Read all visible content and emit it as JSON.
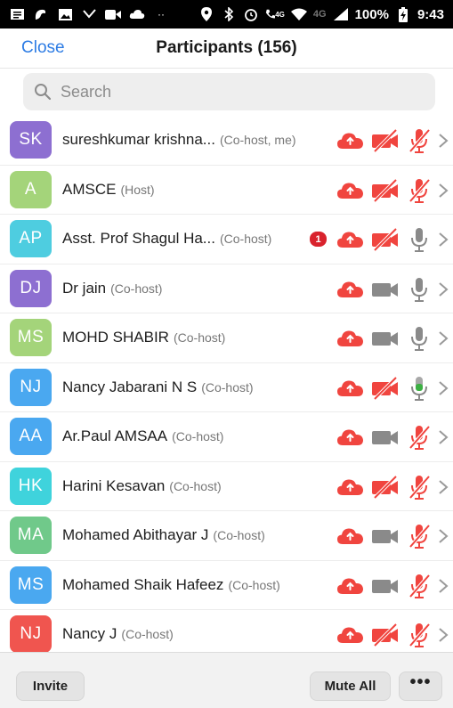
{
  "status_bar": {
    "network": "4G",
    "network_secondary": "4G",
    "battery": "100%",
    "time": "9:43"
  },
  "header": {
    "close_label": "Close",
    "title": "Participants (156)"
  },
  "search": {
    "placeholder": "Search"
  },
  "colors": {
    "accent": "#2d7ce4",
    "red": "#f0453f",
    "gray_icon": "#8a8a8a",
    "green_mic": "#3cb043",
    "badge_red": "#d9232d"
  },
  "participants": [
    {
      "initials": "SK",
      "name": "sureshkumar krishna...",
      "role": "(Co-host, me)",
      "avatar_color": "#8d6fd1",
      "badge": "",
      "cloud": "cloud-icon",
      "video": "video-off-icon",
      "mic": "mic-muted-icon"
    },
    {
      "initials": "A",
      "name": "AMSCE",
      "role": "(Host)",
      "avatar_color": "#a4d47a",
      "badge": "",
      "cloud": "cloud-icon",
      "video": "video-off-icon",
      "mic": "mic-muted-icon"
    },
    {
      "initials": "AP",
      "name": "Asst. Prof Shagul Ha...",
      "role": "(Co-host)",
      "avatar_color": "#4ecde0",
      "badge": "1",
      "cloud": "cloud-icon",
      "video": "video-off-icon",
      "mic": "mic-icon"
    },
    {
      "initials": "DJ",
      "name": "Dr jain",
      "role": "(Co-host)",
      "avatar_color": "#8d6fd1",
      "badge": "",
      "cloud": "cloud-icon",
      "video": "video-icon",
      "mic": "mic-icon"
    },
    {
      "initials": "MS",
      "name": "MOHD SHABIR",
      "role": "(Co-host)",
      "avatar_color": "#a4d47a",
      "badge": "",
      "cloud": "cloud-icon",
      "video": "video-icon",
      "mic": "mic-icon"
    },
    {
      "initials": "NJ",
      "name": "Nancy Jabarani N S",
      "role": "(Co-host)",
      "avatar_color": "#4aa8f0",
      "badge": "",
      "cloud": "cloud-icon",
      "video": "video-off-icon",
      "mic": "mic-active-icon"
    },
    {
      "initials": "AA",
      "name": "Ar.Paul AMSAA",
      "role": "(Co-host)",
      "avatar_color": "#4aa8f0",
      "badge": "",
      "cloud": "cloud-icon",
      "video": "video-icon",
      "mic": "mic-muted-icon"
    },
    {
      "initials": "HK",
      "name": "Harini Kesavan",
      "role": "(Co-host)",
      "avatar_color": "#3fd3dc",
      "badge": "",
      "cloud": "cloud-icon",
      "video": "video-off-icon",
      "mic": "mic-muted-icon"
    },
    {
      "initials": "MA",
      "name": "Mohamed Abithayar J",
      "role": "(Co-host)",
      "avatar_color": "#70c98a",
      "badge": "",
      "cloud": "cloud-icon",
      "video": "video-icon",
      "mic": "mic-muted-icon"
    },
    {
      "initials": "MS",
      "name": "Mohamed Shaik Hafeez",
      "role": "(Co-host)",
      "avatar_color": "#4aa8f0",
      "badge": "",
      "cloud": "cloud-icon",
      "video": "video-icon",
      "mic": "mic-muted-icon"
    },
    {
      "initials": "NJ",
      "name": "Nancy J",
      "role": "(Co-host)",
      "avatar_color": "#f0554f",
      "badge": "",
      "cloud": "cloud-icon",
      "video": "video-off-icon",
      "mic": "mic-muted-icon"
    }
  ],
  "footer": {
    "invite_label": "Invite",
    "mute_all_label": "Mute All",
    "more_label": "•••"
  }
}
